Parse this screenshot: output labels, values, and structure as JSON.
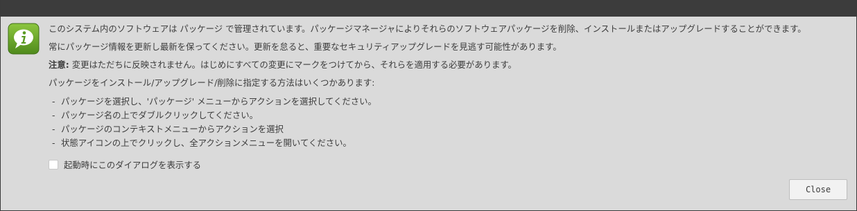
{
  "dialog": {
    "icon": "info-icon",
    "paragraph1": "このシステム内のソフトウェアは パッケージ で管理されています。パッケージマネージャによりそれらのソフトウェアパッケージを削除、インストールまたはアップグレードすることができます。",
    "paragraph2": "常にパッケージ情報を更新し最新を保ってください。更新を怠ると、重要なセキュリティアップグレードを見逃す可能性があります。",
    "note_label": "注意:",
    "note_text": "変更はただちに反映されません。はじめにすべての変更にマークをつけてから、それらを適用する必要があります。",
    "methods_intro": "パッケージをインストール/アップグレード/削除に指定する方法はいくつかあります:",
    "bullet_char": "-",
    "methods": [
      "パッケージを選択し、'パッケージ' メニューからアクションを選択してください。",
      "パッケージ名の上でダブルクリックしてください。",
      "パッケージのコンテキストメニューからアクションを選択",
      "状態アイコンの上でクリックし、全アクションメニューを開いてください。"
    ],
    "checkbox_label": "起動時にこのダイアログを表示する",
    "checkbox_checked": false,
    "close_label": "Close"
  },
  "colors": {
    "titlebar": "#3c3c3c",
    "background": "#dadada",
    "icon_green": "#6aa72a",
    "text": "#3c3c3c"
  }
}
